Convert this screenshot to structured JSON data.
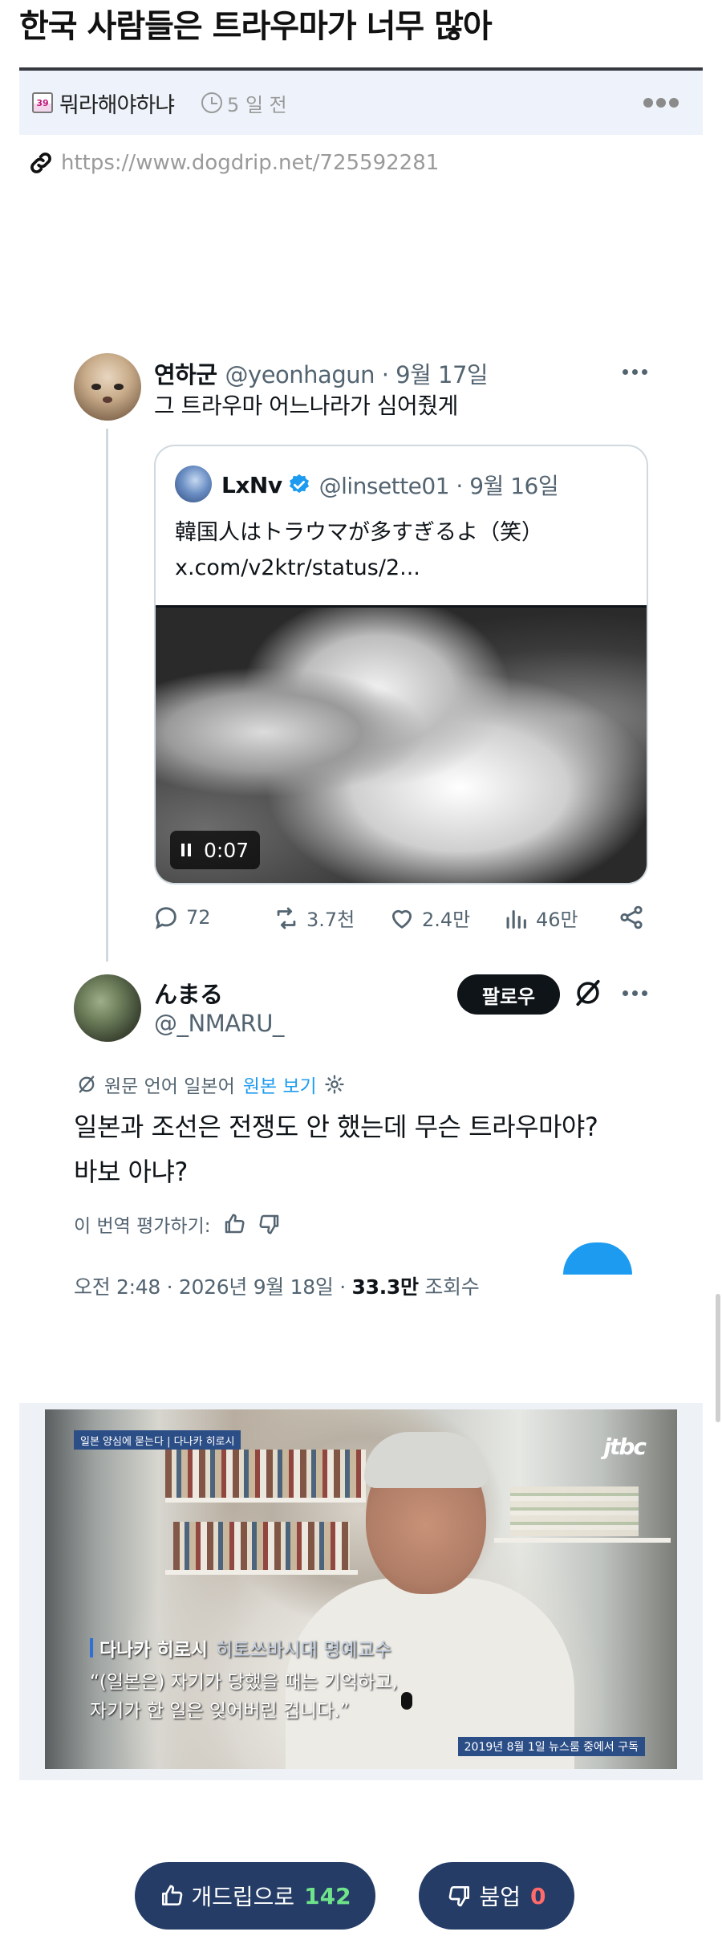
{
  "post": {
    "title": "한국 사람들은 트라우마가 너무 많아",
    "author": "뭐라해야하냐",
    "level_badge": "39",
    "time_ago": "5 일 전",
    "source_url": "https://www.dogdrip.net/725592281"
  },
  "tweet1": {
    "name": "연하군",
    "handle": "@yeonhagun · 9월 17일",
    "text": "그 트라우마 어느나라가 심어줬게"
  },
  "quoted": {
    "name": "LxNv",
    "handle": "@linsette01 · 9월 16일",
    "text_line1": "韓国人はトラウマが多すぎるよ（笑）",
    "text_line2": "x.com/v2ktr/status/2...",
    "video_time": "0:07"
  },
  "actions": {
    "replies": "72",
    "reposts": "3.7천",
    "likes": "2.4만",
    "views": "46만"
  },
  "tweet2": {
    "name": "んまる",
    "handle": "@_NMARU_",
    "follow_label": "팔로우",
    "translate_note": "원문 언어 일본어",
    "view_original": "원본 보기",
    "text_line1": "일본과 조선은 전쟁도 안 했는데 무슨 트라우마야?",
    "text_line2": "바보 아냐?",
    "rate_label": "이 번역 평가하기:",
    "timestamp_pre": "오전 2:48 · 2026년 9월 18일 · ",
    "views_count": "33.3만",
    "views_label": " 조회수"
  },
  "news": {
    "tag": "일본 양심에 묻는다 | 다나카 히로시",
    "logo": "jtbc",
    "name": "다나카 히로시",
    "role": "히토쓰바시대 명예교수",
    "line1": "“(일본은) 자기가 당했을 때는 기억하고,",
    "line2": "자기가 한 일은 잊어버린 겁니다.”",
    "date": "2019년 8월 1일 뉴스룸 중에서 구독"
  },
  "votes": {
    "up_label": "개드립으로",
    "up_count": "142",
    "down_label": "붐업",
    "down_count": "0"
  },
  "colors": {
    "accent_blue": "#1d9bf0",
    "vote_bg": "#243c66",
    "up_green": "#6fe38a",
    "down_red": "#ff6a6a"
  }
}
